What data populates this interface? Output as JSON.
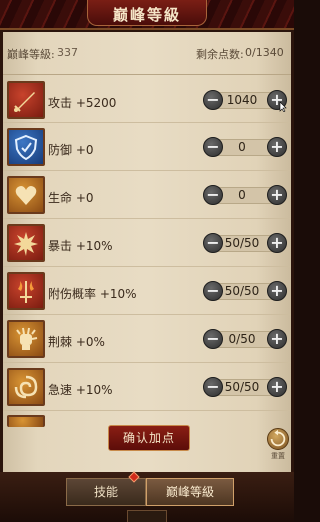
{
  "header": {
    "title": "巅峰等級"
  },
  "stats": {
    "level_label": "巅峰等級:",
    "level_value": "337",
    "points_label": "剩余点数:",
    "points_value": "0/1340"
  },
  "attributes": [
    {
      "label": "攻击 +5200",
      "value": "1040",
      "icon": "sword-icon",
      "icon_color": "red"
    },
    {
      "label": "防御 +0",
      "value": "0",
      "icon": "shield-icon",
      "icon_color": "blue"
    },
    {
      "label": "生命 +0",
      "value": "0",
      "icon": "heart-icon",
      "icon_color": "gold"
    },
    {
      "label": "暴击 +10%",
      "value": "50/50",
      "icon": "burst-icon",
      "icon_color": "red"
    },
    {
      "label": "附伤概率 +10%",
      "value": "50/50",
      "icon": "sword-fire-icon",
      "icon_color": "red"
    },
    {
      "label": "荆棘 +0%",
      "value": "0/50",
      "icon": "thorn-fist-icon",
      "icon_color": "gold"
    },
    {
      "label": "急速 +10%",
      "value": "50/50",
      "icon": "swirl-icon",
      "icon_color": "gold"
    }
  ],
  "controls": {
    "minus_symbol": "−",
    "plus_symbol": "+"
  },
  "footer": {
    "confirm_label": "确认加点",
    "reset_label": "重置"
  },
  "tabs": [
    {
      "label": "技能"
    },
    {
      "label": "巅峰等級"
    }
  ],
  "colors": {
    "accent_red": "#7a1e15",
    "panel_bg": "#e3d6bc",
    "button_dark": "#2e2e2e"
  }
}
